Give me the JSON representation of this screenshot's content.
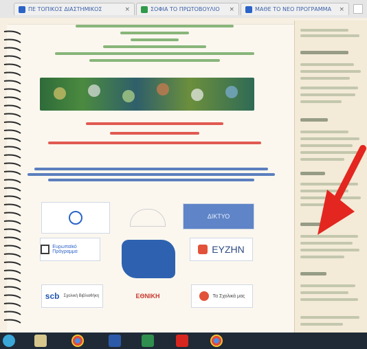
{
  "browser": {
    "tabs": [
      {
        "label": "ΠΕ ΤΟΠΙΚΟΣ ΔΙΑΣΤΗΜΙΚΟΣ",
        "color": "#2b63c7"
      },
      {
        "label": "ΣΟΦΙΑ ΤΟ ΠΡΩΤΟΒΟΥΛΙΟ",
        "color": "#2f9a4a"
      },
      {
        "label": "ΜΑΘΕ ΤΟ ΝΕΟ ΠΡΟΓΡΑΜΜΑ",
        "color": "#2b63c7"
      }
    ]
  },
  "logos": {
    "left_top": "",
    "right_top": "ΔΙΚΤΥΟ",
    "left_mid": "Ευρωπαϊκό Πρόγραμμα",
    "right_mid": "EYZHN",
    "left_bottom_brand": "scb",
    "left_bottom_text": "Σχολική Βιβλιοθήκη",
    "center_bottom": "ΕΘΝΙΚΗ",
    "right_bottom": "Τα Σχολικά μας"
  },
  "taskbar": {
    "icons": [
      "windows",
      "explorer",
      "chrome",
      "word",
      "excel",
      "acrobat",
      "chrome-2"
    ]
  }
}
